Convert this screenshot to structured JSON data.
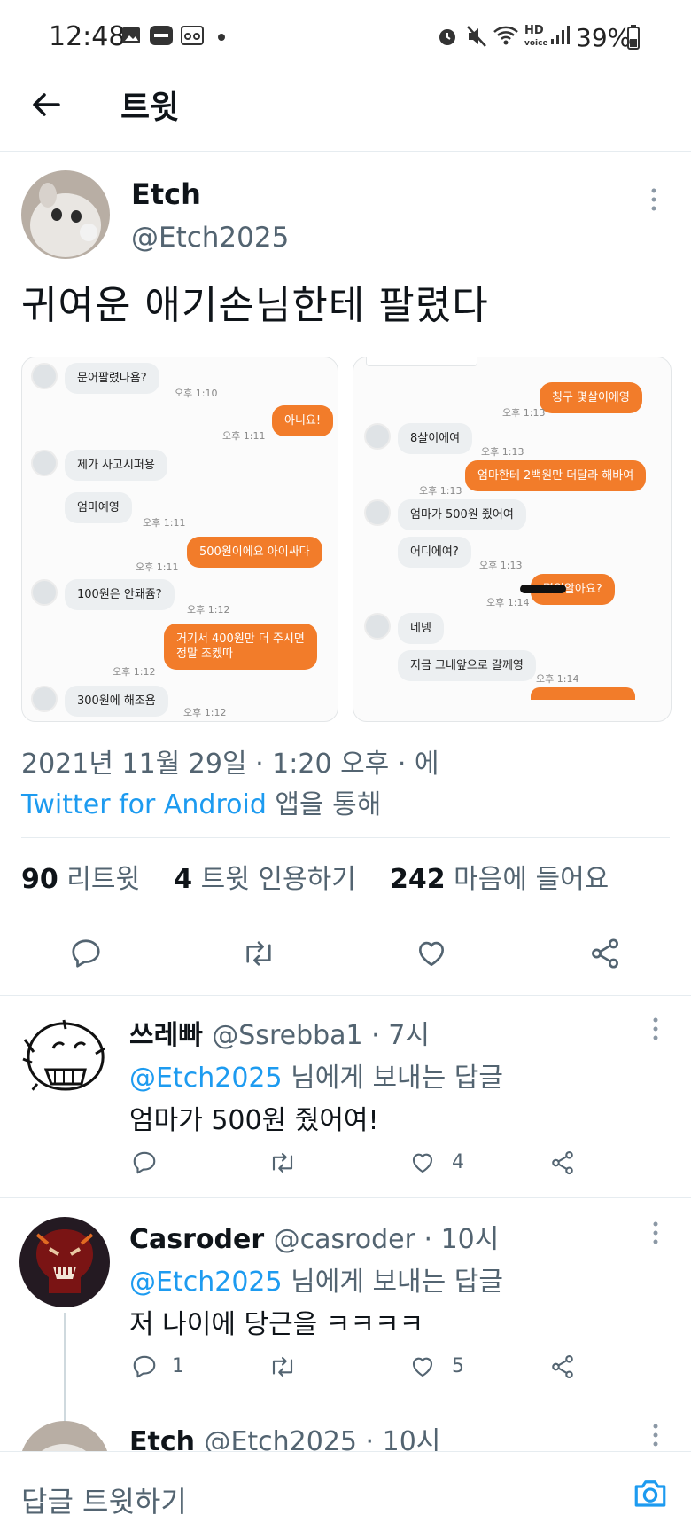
{
  "status_bar": {
    "time": "12:48",
    "battery": "39%"
  },
  "header": {
    "title": "트윗"
  },
  "tweet": {
    "name": "Etch",
    "handle": "@Etch2025",
    "text": "귀여운 애기손님한테 팔렸다",
    "date": "2021년 11월 29일 · 1:20 오후 · 에",
    "via_app": "Twitter for Android",
    "via_suffix": " 앱을 통해",
    "stats": {
      "retweets": "90",
      "retweets_label": " 리트윗",
      "quotes": "4",
      "quotes_label": " 트윗 인용하기",
      "likes": "242",
      "likes_label": " 마음에 들어요"
    },
    "screenshot1": {
      "m1": "문어팔렸나욤?",
      "t1": "오후 1:10",
      "m2": "아니요!",
      "t2": "오후 1:11",
      "m3": "제가 사고시퍼용",
      "m4": "엄마예영",
      "t4": "오후 1:11",
      "m5": "500원이에요 아이싸다",
      "t5": "오후 1:11",
      "m6": "100원은 안돼쥼?",
      "t6": "오후 1:12",
      "m7a": "거기서 400원만 더 주시면",
      "m7b": "정말 조켔따",
      "t7": "오후 1:12",
      "m8": "300원에 해조욤",
      "t8": "오후 1:12"
    },
    "screenshot2": {
      "m1": "칭구 몇살이에영",
      "t1": "오후 1:13",
      "m2": "8살이에여",
      "t2": "오후 1:13",
      "m3": "엄마한테 2백원만 더달라 해바여",
      "t3": "오후 1:13",
      "m4": "엄마가 500원 줬어여",
      "m5": "어디에여?",
      "t5": "오후 1:13",
      "m6": "몇원알아요?",
      "t6": "오후 1:14",
      "m7": "네넹",
      "m8": "지금 그네앞으로 갈께영",
      "t8": "오후 1:14"
    }
  },
  "replies": [
    {
      "name": "쓰레빠",
      "handle": "@Ssrebba1 · 7시",
      "to_mention": "@Etch2025",
      "to_suffix": " 님에게 보내는 답글",
      "text": "엄마가 500원 줬어여!",
      "replies_count": "",
      "likes_count": "4"
    },
    {
      "name": "Casroder",
      "handle": "@casroder · 10시",
      "to_mention": "@Etch2025",
      "to_suffix": " 님에게 보내는 답글",
      "text": "저 나이에 당근을 ㅋㅋㅋㅋ",
      "replies_count": "1",
      "likes_count": "5"
    },
    {
      "name": "Etch",
      "handle": "@Etch2025 · 10시"
    }
  ],
  "compose": {
    "placeholder": "답글 트윗하기"
  },
  "colors": {
    "accent": "#1d9bf0",
    "orange_bubble": "#f27c2a"
  }
}
